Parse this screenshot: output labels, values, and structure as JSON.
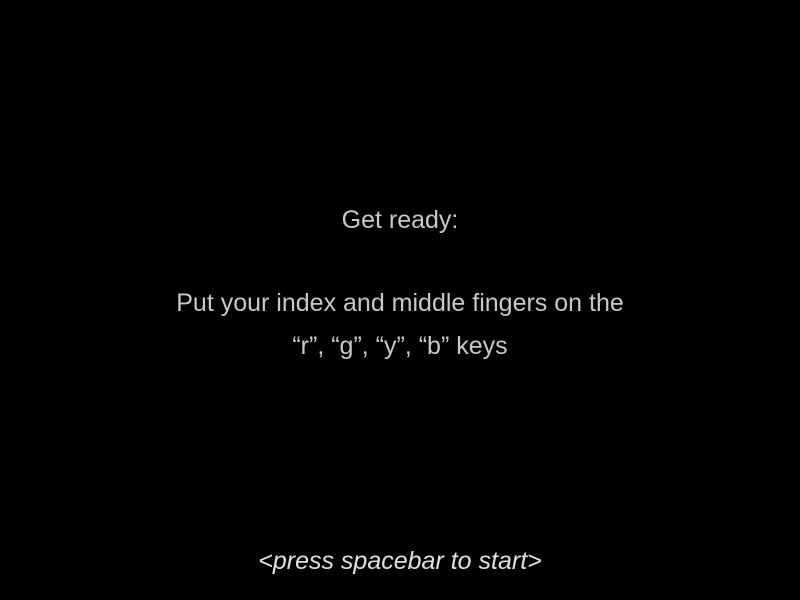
{
  "screen": {
    "heading": "Get ready:",
    "instruction_line1": "Put your index and middle fingers on the",
    "instruction_line2": "“r”, “g”, “y”, “b” keys",
    "start_prompt": "<press spacebar to start>"
  },
  "colors": {
    "background": "#000000",
    "text": "#c8c8c8"
  }
}
